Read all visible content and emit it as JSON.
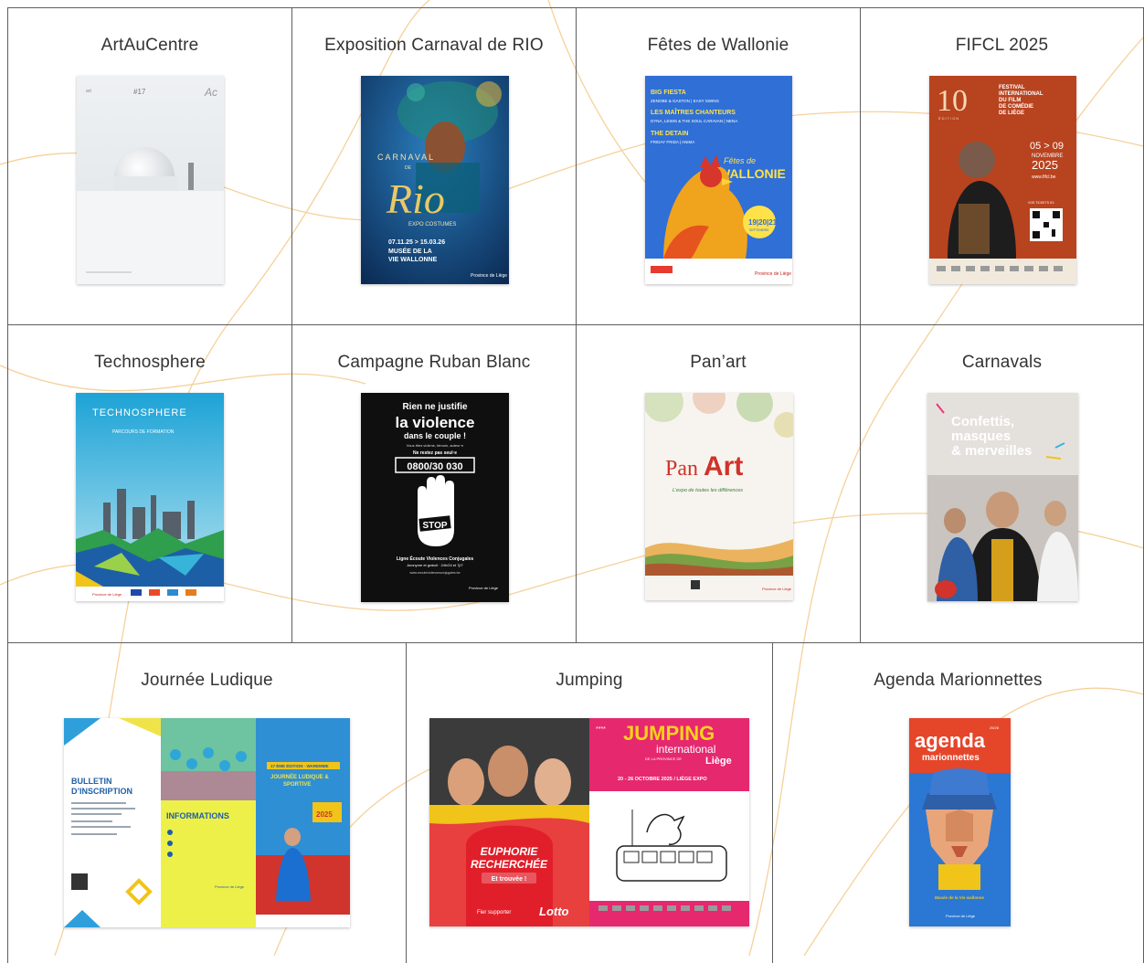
{
  "rows": [
    [
      {
        "label": "ArtAuCentre"
      },
      {
        "label": "Exposition Carnaval de RIO"
      },
      {
        "label": "Fêtes de Wallonie"
      },
      {
        "label": "FIFCL 2025"
      }
    ],
    [
      {
        "label": "Technosphere"
      },
      {
        "label": "Campagne Ruban Blanc"
      },
      {
        "label": "Pan’art"
      },
      {
        "label": "Carnavals"
      }
    ],
    [
      {
        "label": "Journée Ludique"
      },
      {
        "label": "Jumping"
      },
      {
        "label": "Agenda Marionnettes"
      }
    ]
  ],
  "posters": {
    "artaucentre": {
      "issue": "#17",
      "mark": "Ac"
    },
    "rio": {
      "top": "CARNAVAL",
      "de": "DE",
      "big": "Rio",
      "sub": "EXPO COSTUMES",
      "dates": "07.11.25 > 15.03.26",
      "venue1": "MUSÉE DE LA",
      "venue2": "VIE WALLONNE",
      "brand": "Province de Liège"
    },
    "wallonie": {
      "l1": "BIG FIESTA",
      "l2": "ZENOBE & GASTON | EASY SWING",
      "l3": "LES MAÎTRES CHANTEURS",
      "l4": "DYNA, LEWIS & THE SOUL CARAVAN | NENA",
      "l5": "THE DETAIN",
      "l6": "FRIDAY FRIDA | ANIMA",
      "title1": "Fêtes de",
      "title2": "WALLONIE",
      "dates": "19|20|21",
      "month": "SEPTEMBRE",
      "brand": "Province de Liège"
    },
    "fifcl": {
      "num": "10",
      "edition": "ÉDITION",
      "t1": "FESTIVAL",
      "t2": "INTERNATIONAL",
      "t3": "DU FILM",
      "t4": "DE COMÉDIE",
      "t5": "DE LIÈGE",
      "dates": "05 > 09",
      "month": "NOVEMBRE",
      "year": "2025",
      "site": "www.fifcl.be",
      "tickets": "VOS TICKETS ICI"
    },
    "techno": {
      "title": "TECHNOSPHERE",
      "sub": "PARCOURS DE FORMATION",
      "brand": "Province de Liège"
    },
    "ruban": {
      "l1": "Rien ne justifie",
      "l2": "la violence",
      "l3": "dans le couple !",
      "l4": "Vous êtes victime, témoin, auteur·e",
      "l5": "Ne restez pas seul·e",
      "phone": "0800/30 030",
      "stop": "STOP",
      "l6": "Ligne Écoute Violences Conjugales",
      "l7": "Anonyme et gratuit · 24h/24 et 7j/7",
      "site": "www.ecouteviolencesconjugales.be",
      "brand": "Province de Liège"
    },
    "panart": {
      "title1": "Pan",
      "title2": "Art",
      "sub": "L’expo de toutes les différences",
      "brand": "Province de Liège"
    },
    "carnavals": {
      "l1": "Confettis,",
      "l2": "masques",
      "l3": "& merveilles"
    },
    "ludique": {
      "b1": "BULLETIN",
      "b2": "D’INSCRIPTION",
      "info": "INFORMATIONS",
      "ed": "17 ÈME ÉDITION · WAREMME",
      "t1": "JOURNÉE LUDIQUE &",
      "t2": "SPORTIVE",
      "year": "2025",
      "brand": "Province de Liège"
    },
    "jumping": {
      "euph1": "EUPHORIE",
      "euph2": "RECHERCHÉE",
      "found": "Et trouvée !",
      "sponsor": "Fier supporter",
      "lotto": "Lotto",
      "t1": "JUMPING",
      "t2": "international",
      "t3": "DE LA PROVINCE DE",
      "t4": "Liège",
      "dates": "20 - 26 OCTOBRE 2025 / LIÈGE EXPO",
      "stars": "****"
    },
    "marionnettes": {
      "title": "agenda",
      "sub": "marionnettes",
      "year": "25/26",
      "museum": "Musée de la Vie wallonne",
      "brand": "Province de Liège"
    }
  }
}
